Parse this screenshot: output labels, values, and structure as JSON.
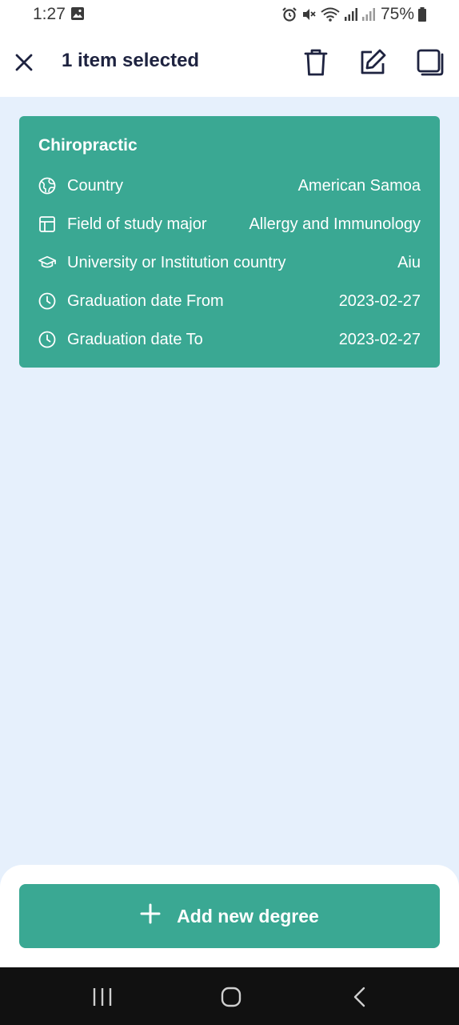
{
  "status_bar": {
    "time": "1:27",
    "battery": "75%",
    "icons": [
      "gallery-icon",
      "alarm-icon",
      "mute-icon",
      "wifi-icon",
      "signal-icon",
      "signal-icon",
      "battery-icon"
    ]
  },
  "action_bar": {
    "title": "1 item selected",
    "icons": [
      "close-icon",
      "trash-icon",
      "edit-icon",
      "copy-icon"
    ]
  },
  "degree_card": {
    "title": "Chiropractic",
    "rows": [
      {
        "icon": "globe-icon",
        "label": "Country",
        "value": "American Samoa"
      },
      {
        "icon": "layout-icon",
        "label": "Field of study major",
        "value": "Allergy and Immunology"
      },
      {
        "icon": "graduation-cap-icon",
        "label": "University or Institution country",
        "value": "Aiu"
      },
      {
        "icon": "clock-icon",
        "label": "Graduation date From",
        "value": "2023-02-27"
      },
      {
        "icon": "clock-icon",
        "label": "Graduation date To",
        "value": "2023-02-27"
      }
    ]
  },
  "add_button": {
    "label": "Add new degree",
    "icon": "plus-icon"
  },
  "nav_bar": {
    "icons": [
      "recents-icon",
      "home-icon",
      "back-icon"
    ]
  },
  "colors": {
    "accent": "#3aa893",
    "background": "#e6f0fc",
    "title_text": "#1e2340"
  }
}
